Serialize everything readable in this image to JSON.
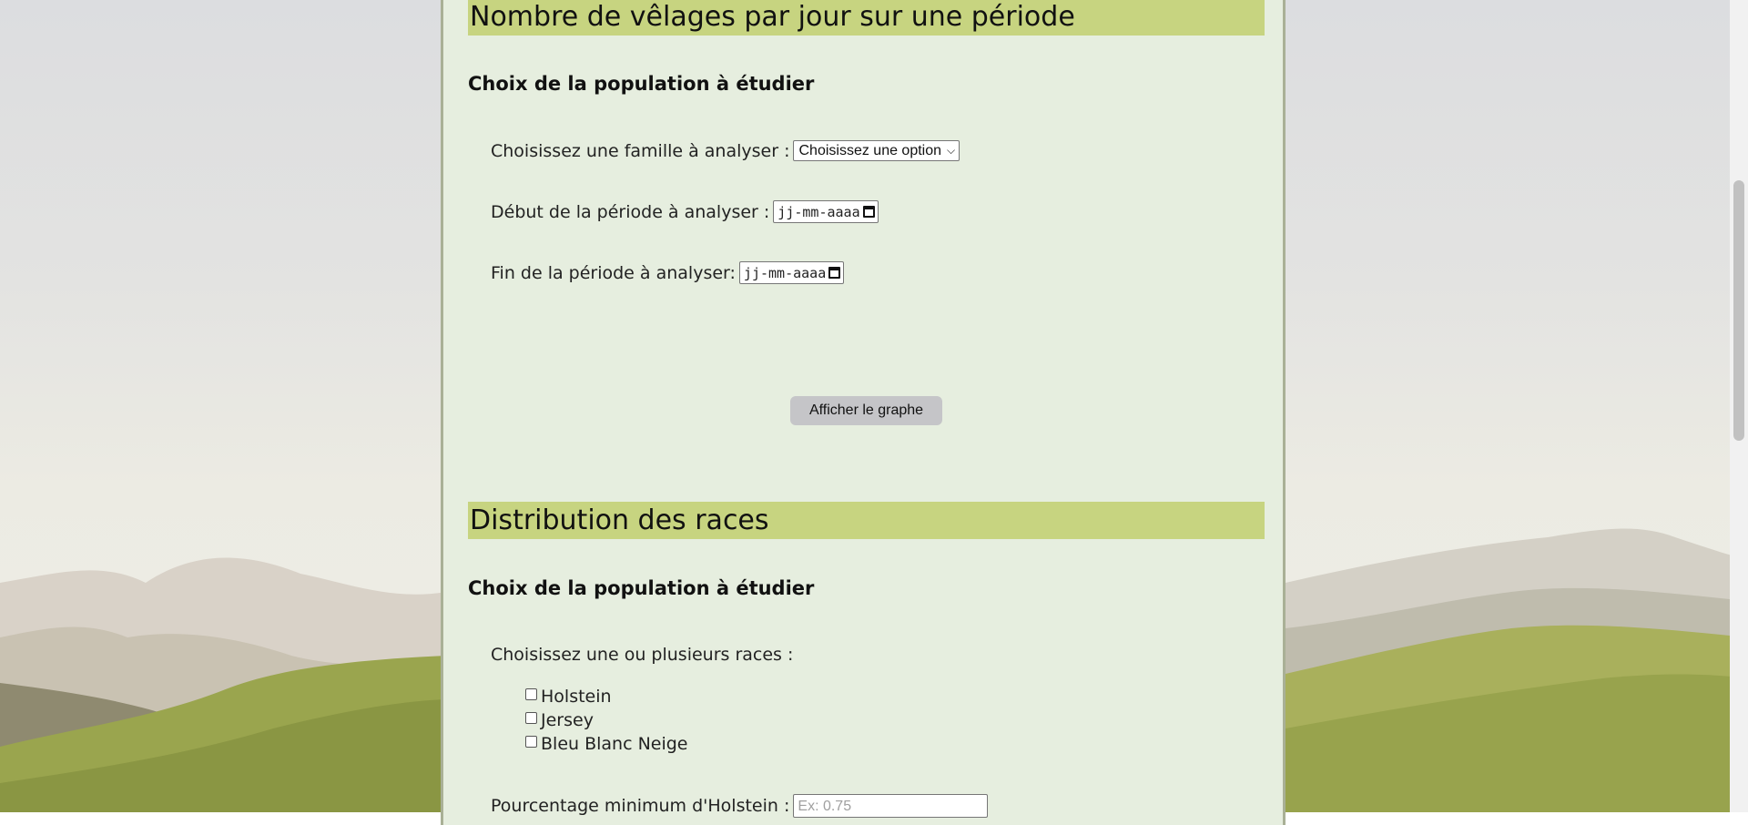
{
  "section1": {
    "title": "Nombre de vêlages par jour sur une période",
    "subtitle": "Choix de la population à étudier",
    "family_label": "Choisissez une famille à analyser :",
    "family_select_value": "Choisissez une option",
    "start_label": "Début de la période à analyser :",
    "start_value": "jj-mm-aaaa",
    "end_label": "Fin de la période à analyser:",
    "end_value": "jj-mm-aaaa",
    "button_label": "Afficher le graphe"
  },
  "section2": {
    "title": "Distribution des races",
    "subtitle": "Choix de la population à étudier",
    "races_label": "Choisissez une ou plusieurs races :",
    "races": [
      {
        "label": "Holstein",
        "checked": false
      },
      {
        "label": "Jersey",
        "checked": false
      },
      {
        "label": "Bleu Blanc Neige",
        "checked": false
      }
    ],
    "holstein_pct_label": "Pourcentage minimum d'Holstein :",
    "holstein_pct_placeholder": "Ex: 0.75"
  },
  "colors": {
    "panel_bg": "#e6eedf",
    "section_header_bg": "#c7d480",
    "button_bg": "#c5c5c8"
  }
}
